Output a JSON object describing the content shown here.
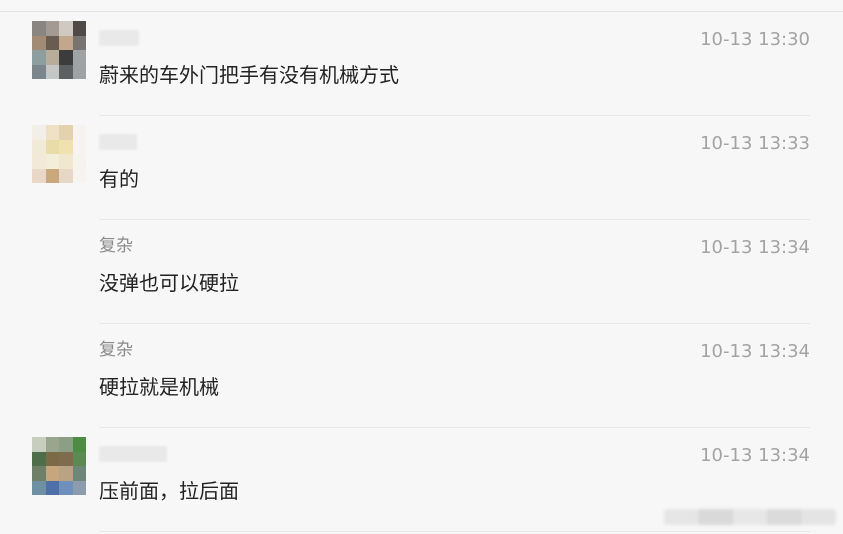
{
  "messages": [
    {
      "name": "",
      "time": "10-13 13:30",
      "text": "蔚来的车外门把手有没有机械方式",
      "avatar": [
        "#8a8581",
        "#a39a93",
        "#cfc9c2",
        "#4d4a48",
        "#a28b74",
        "#6b5c51",
        "#c2a78c",
        "#7a7470",
        "#8d9e9f",
        "#b8ad9b",
        "#3c3c3c",
        "#a0a3a6",
        "#7b868c",
        "#c5c7c6",
        "#5d6063",
        "#9ea2a5"
      ]
    },
    {
      "name": "",
      "time": "10-13 13:33",
      "text": "有的",
      "avatar": [
        "#f4eee8",
        "#efe2c4",
        "#e3d2ae",
        "#f7f3ef",
        "#f1ead7",
        "#e8dca8",
        "#efe2b0",
        "#f7f3ee",
        "#f2e9d8",
        "#f4eed8",
        "#f1e7cf",
        "#f6f2ec",
        "#e9d8c8",
        "#c9a87e",
        "#e7d7c7",
        "#f7f4f0"
      ]
    },
    {
      "name": "复杂",
      "time": "10-13 13:34",
      "text": "没弹也可以硬拉"
    },
    {
      "name": "复杂",
      "time": "10-13 13:34",
      "text": "硬拉就是机械"
    },
    {
      "name": "",
      "time": "10-13 13:34",
      "text": "压前面，拉后面",
      "avatar": [
        "#c7cdbf",
        "#9aa58e",
        "#8a9f84",
        "#4e8b43",
        "#4e6e49",
        "#7c6a47",
        "#7f6b4d",
        "#5b8b53",
        "#6f8069",
        "#c6a67d",
        "#b9a384",
        "#6d8879",
        "#6f8fa2",
        "#4e6fa8",
        "#6f8fbd",
        "#8c9bad"
      ]
    }
  ],
  "colors": {
    "background": "#f7f7f7",
    "divider": "#e7e7e7",
    "text": "#222222",
    "meta": "#a3a3a3"
  }
}
